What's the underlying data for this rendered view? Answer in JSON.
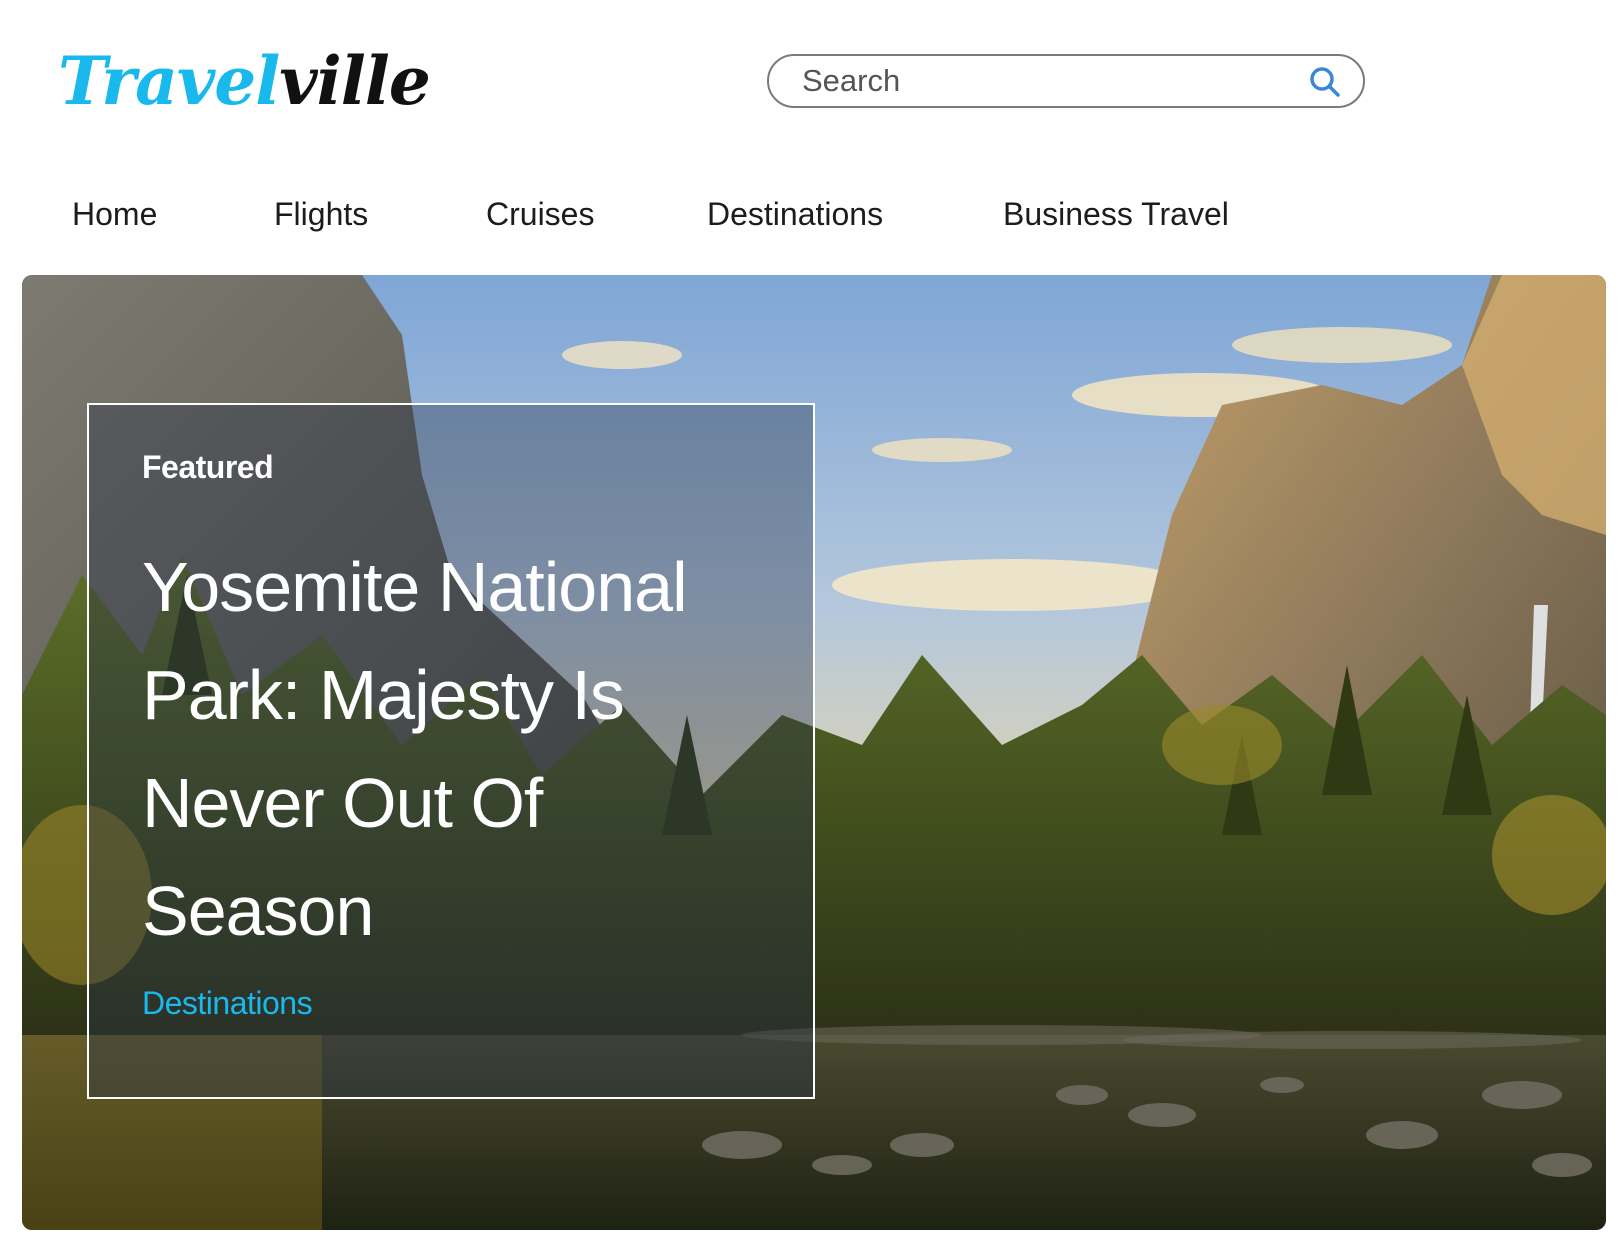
{
  "header": {
    "logo_part1": "Travel",
    "logo_part2": "ville",
    "search_placeholder": "Search"
  },
  "nav": {
    "items": [
      {
        "label": "Home"
      },
      {
        "label": "Flights"
      },
      {
        "label": "Cruises"
      },
      {
        "label": "Destinations"
      },
      {
        "label": "Business Travel"
      }
    ]
  },
  "hero": {
    "feature_label": "Featured",
    "title": "Yosemite National Park: Majesty Is Never Out Of Season",
    "category": "Destinations"
  },
  "colors": {
    "brand": "#19b9ee",
    "logo_dark": "#111111",
    "search_icon": "#3a86d8"
  },
  "icons": {
    "search": "search-icon"
  }
}
